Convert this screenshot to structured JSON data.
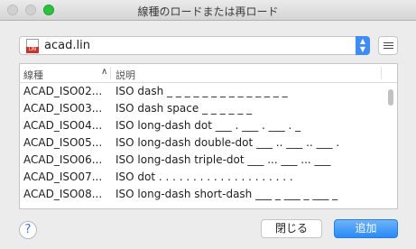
{
  "window": {
    "title": "線種のロードまたは再ロード"
  },
  "file_selector": {
    "value": "acad.lin",
    "icon": "lin-file-icon",
    "icon_tag": "LIN"
  },
  "table": {
    "headers": {
      "name": "線種",
      "description": "説明"
    },
    "rows": [
      {
        "name": "ACAD_ISO02...",
        "description": "ISO dash _ _ _ _ _ _ _ _ _ _ _ _ _ _"
      },
      {
        "name": "ACAD_ISO03...",
        "description": "ISO dash space _   _   _   _   _   _"
      },
      {
        "name": "ACAD_ISO04...",
        "description": "ISO long-dash dot ___ . ___ . ___ . _"
      },
      {
        "name": "ACAD_ISO05...",
        "description": "ISO long-dash double-dot ___ .. ___ .. ___ ."
      },
      {
        "name": "ACAD_ISO06...",
        "description": "ISO long-dash triple-dot ___ ... ___ ... ___"
      },
      {
        "name": "ACAD_ISO07...",
        "description": "ISO dot . . . . . . . . . . . . . . . . . . . ."
      },
      {
        "name": "ACAD_ISO08...",
        "description": "ISO long-dash short-dash ___ _ ___ _ ___ _"
      }
    ]
  },
  "buttons": {
    "help": "?",
    "close": "閉じる",
    "add": "追加"
  }
}
